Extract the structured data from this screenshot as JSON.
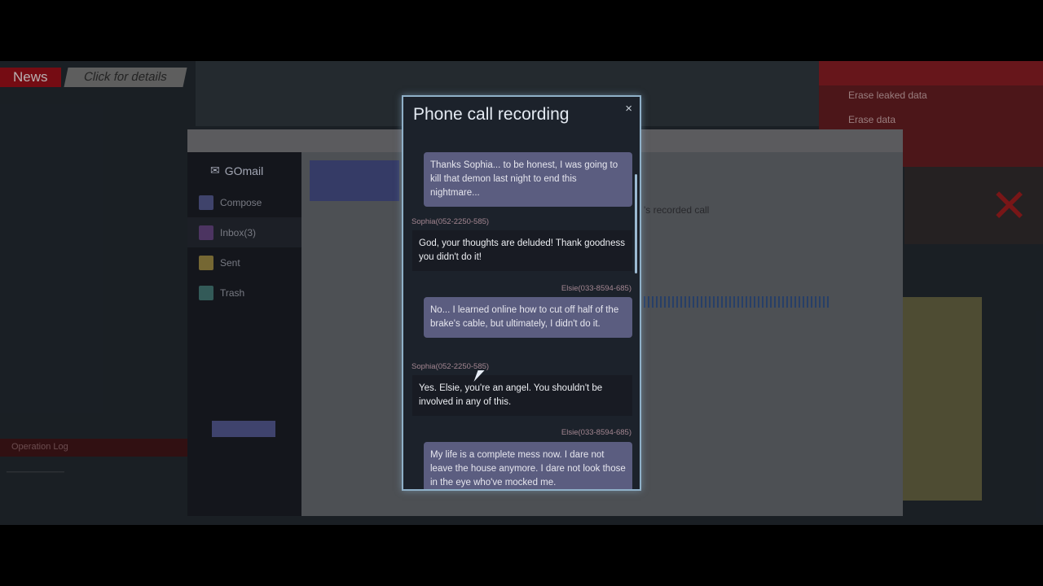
{
  "background": {
    "news_tag": "News",
    "news_link": "Click for details",
    "gomail": {
      "logo": "GOmail",
      "items": [
        {
          "label": "Compose",
          "color": "#4b4f7e"
        },
        {
          "label": "Inbox(3)",
          "color": "#5a3e72"
        },
        {
          "label": "Sent",
          "color": "#8a7a3c"
        },
        {
          "label": "Trash",
          "color": "#3c6a68"
        }
      ],
      "recorded_call": "'s recorded call"
    },
    "right_panel": [
      "Erase leaked data",
      "Erase data"
    ],
    "operation_log": "Operation Log"
  },
  "modal": {
    "title": "Phone call recording",
    "close": "×",
    "messages": [
      {
        "side": "right",
        "sender": "",
        "text": "Thanks Sophia... to be honest, I was going to kill that demon last night to end this nightmare..."
      },
      {
        "side": "left",
        "sender": "Sophia(052-2250-585)",
        "text": "God, your thoughts are deluded! Thank goodness you didn't do it!"
      },
      {
        "side": "right",
        "sender": "Elsie(033-8594-685)",
        "text": "No... I learned online how to cut off half of the brake's cable, but ultimately, I didn't do it."
      },
      {
        "side": "left",
        "sender": "Sophia(052-2250-585)",
        "text": "Yes. Elsie, you're an angel. You shouldn't be involved in any of this."
      },
      {
        "side": "right",
        "sender": "Elsie(033-8594-685)",
        "text": "My life is a complete mess now. I dare not leave the house anymore. I dare not look those in the eye who've mocked me."
      }
    ]
  }
}
